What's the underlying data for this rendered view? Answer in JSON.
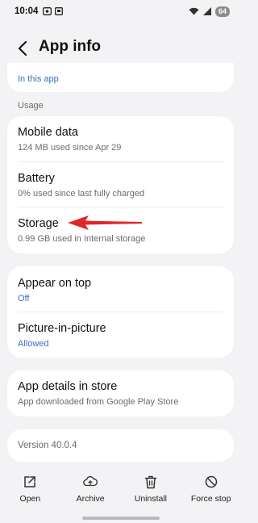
{
  "status_bar": {
    "time": "10:04",
    "battery": "64"
  },
  "header": {
    "title": "App info"
  },
  "top_card": {
    "link": "In this app"
  },
  "usage": {
    "section_label": "Usage",
    "items": [
      {
        "title": "Mobile data",
        "subtitle": "124 MB used since Apr 29"
      },
      {
        "title": "Battery",
        "subtitle": "0% used since last fully charged"
      },
      {
        "title": "Storage",
        "subtitle": "0.99 GB used in Internal storage"
      }
    ]
  },
  "permissions": {
    "items": [
      {
        "title": "Appear on top",
        "value": "Off"
      },
      {
        "title": "Picture-in-picture",
        "value": "Allowed"
      }
    ]
  },
  "store": {
    "title": "App details in store",
    "subtitle": "App downloaded from Google Play Store"
  },
  "version": {
    "text": "Version 40.0.4"
  },
  "bottom_bar": {
    "items": [
      {
        "label": "Open",
        "icon": "open-external-icon"
      },
      {
        "label": "Archive",
        "icon": "cloud-upload-icon"
      },
      {
        "label": "Uninstall",
        "icon": "trash-icon"
      },
      {
        "label": "Force stop",
        "icon": "block-icon"
      }
    ]
  },
  "colors": {
    "accent_blue": "#3b6fc4",
    "annotation_arrow": "#e0262a",
    "background": "#f3f3f5"
  }
}
